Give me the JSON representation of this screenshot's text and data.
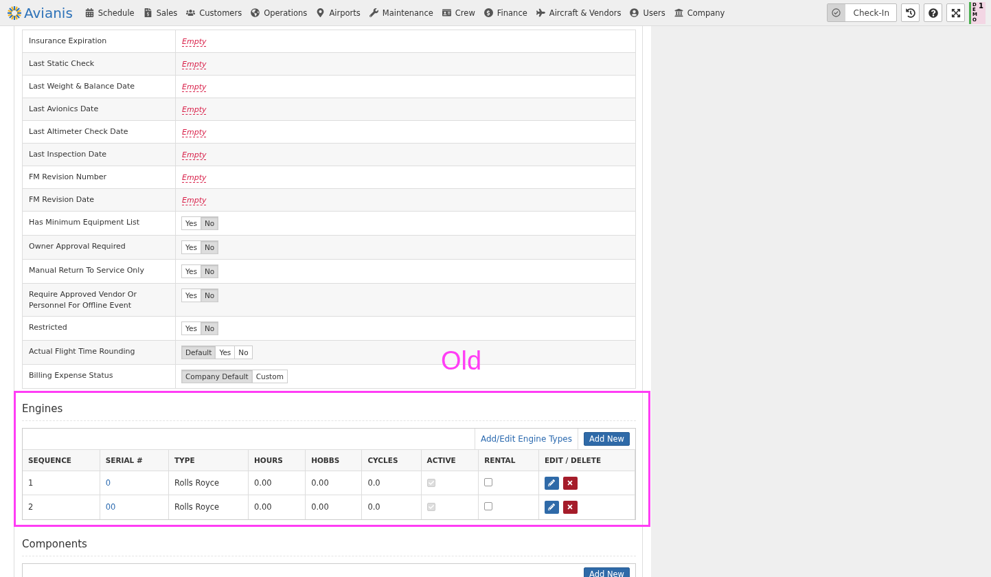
{
  "brand": "Avianis",
  "nav": [
    "Schedule",
    "Sales",
    "Customers",
    "Operations",
    "Airports",
    "Maintenance",
    "Crew",
    "Finance",
    "Aircraft & Vendors",
    "Users",
    "Company"
  ],
  "check_in": {
    "label": "Check-In"
  },
  "demo_badge": {
    "label": "DEMO",
    "count": "1"
  },
  "properties": [
    {
      "label": "Insurance Expiration",
      "kind": "empty",
      "value": "Empty"
    },
    {
      "label": "Last Static Check",
      "kind": "empty",
      "value": "Empty"
    },
    {
      "label": "Last Weight & Balance Date",
      "kind": "empty",
      "value": "Empty"
    },
    {
      "label": "Last Avionics Date",
      "kind": "empty",
      "value": "Empty"
    },
    {
      "label": "Last Altimeter Check Date",
      "kind": "empty",
      "value": "Empty"
    },
    {
      "label": "Last Inspection Date",
      "kind": "empty",
      "value": "Empty"
    },
    {
      "label": "FM Revision Number",
      "kind": "empty",
      "value": "Empty"
    },
    {
      "label": "FM Revision Date",
      "kind": "empty",
      "value": "Empty"
    },
    {
      "label": "Has Minimum Equipment List",
      "kind": "toggle",
      "options": [
        {
          "label": "Yes",
          "selected": false
        },
        {
          "label": "No",
          "selected": true
        }
      ]
    },
    {
      "label": "Owner Approval Required",
      "kind": "toggle",
      "options": [
        {
          "label": "Yes",
          "selected": false
        },
        {
          "label": "No",
          "selected": true
        }
      ]
    },
    {
      "label": "Manual Return To Service Only",
      "kind": "toggle",
      "options": [
        {
          "label": "Yes",
          "selected": false
        },
        {
          "label": "No",
          "selected": true
        }
      ]
    },
    {
      "label": "Require Approved Vendor Or Personnel For Offline Event",
      "kind": "toggle",
      "options": [
        {
          "label": "Yes",
          "selected": false
        },
        {
          "label": "No",
          "selected": true
        }
      ]
    },
    {
      "label": "Restricted",
      "kind": "toggle",
      "options": [
        {
          "label": "Yes",
          "selected": false
        },
        {
          "label": "No",
          "selected": true
        }
      ]
    },
    {
      "label": "Actual Flight Time Rounding",
      "kind": "toggle",
      "options": [
        {
          "label": "Default",
          "selected": true
        },
        {
          "label": "Yes",
          "selected": false
        },
        {
          "label": "No",
          "selected": false
        }
      ]
    },
    {
      "label": "Billing Expense Status",
      "kind": "toggle",
      "options": [
        {
          "label": "Company Default",
          "selected": true
        },
        {
          "label": "Custom",
          "selected": false
        }
      ]
    }
  ],
  "annotation": {
    "label": "Old"
  },
  "engines": {
    "title": "Engines",
    "link": "Add/Edit Engine Types",
    "add_button": "Add New",
    "columns": [
      "SEQUENCE",
      "SERIAL #",
      "TYPE",
      "HOURS",
      "HOBBS",
      "CYCLES",
      "ACTIVE",
      "RENTAL",
      "EDIT / DELETE"
    ],
    "rows": [
      {
        "sequence": "1",
        "serial": "0",
        "type": "Rolls Royce",
        "hours": "0.00",
        "hobbs": "0.00",
        "cycles": "0.0",
        "active": true,
        "rental": false
      },
      {
        "sequence": "2",
        "serial": "00",
        "type": "Rolls Royce",
        "hours": "0.00",
        "hobbs": "0.00",
        "cycles": "0.0",
        "active": true,
        "rental": false
      }
    ]
  },
  "components": {
    "title": "Components",
    "add_button": "Add New"
  }
}
